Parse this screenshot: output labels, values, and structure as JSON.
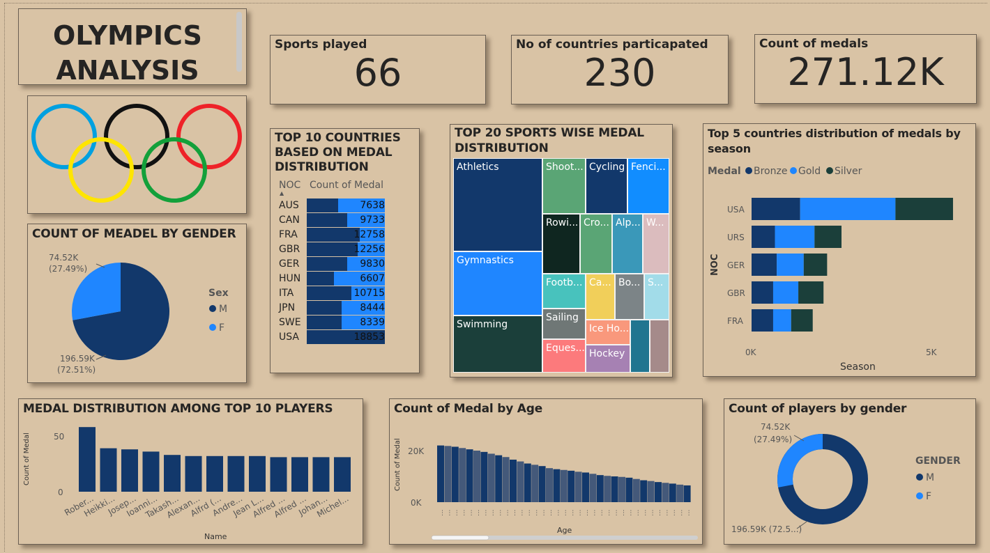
{
  "title": {
    "line1": "OLYMPICS",
    "line2": "ANALYSIS"
  },
  "kpis": [
    {
      "label": "Sports played",
      "value": "66"
    },
    {
      "label": "No of countries particapated",
      "value": "230"
    },
    {
      "label": "Count of medals",
      "value": "271.12K"
    }
  ],
  "colors": {
    "background": "#d9c3a5",
    "dark_blue": "#12386b",
    "mid_blue": "#1f86ff",
    "dark_green": "#1b3f3a"
  },
  "gender_pie": {
    "title": "COUNT OF MEADEL BY GENDER",
    "legend_title": "Sex",
    "legend": [
      "M",
      "F"
    ],
    "label_f": "74.52K",
    "label_f_pct": "(27.49%)",
    "label_m": "196.59K",
    "label_m_pct": "(72.51%)"
  },
  "top10_table": {
    "title_l1": "TOP 10 COUNTRIES",
    "title_l2": "BASED ON MEDAL",
    "title_l3": "DISTRIBUTION",
    "col_noc": "NOC",
    "col_count": "Count of Medal",
    "rows": [
      {
        "noc": "AUS",
        "count": "7638"
      },
      {
        "noc": "CAN",
        "count": "9733"
      },
      {
        "noc": "FRA",
        "count": "12758"
      },
      {
        "noc": "GBR",
        "count": "12256"
      },
      {
        "noc": "GER",
        "count": "9830"
      },
      {
        "noc": "HUN",
        "count": "6607"
      },
      {
        "noc": "ITA",
        "count": "10715"
      },
      {
        "noc": "JPN",
        "count": "8444"
      },
      {
        "noc": "SWE",
        "count": "8339"
      },
      {
        "noc": "USA",
        "count": "18853"
      }
    ]
  },
  "treemap": {
    "title_l1": "TOP 20 SPORTS WISE MEDAL",
    "title_l2": "DISTRIBUTION",
    "labels": [
      "Athletics",
      "Gymnastics",
      "Swimming",
      "Shoot...",
      "Cycling",
      "Fenci...",
      "Rowi...",
      "Cro...",
      "Alp...",
      "W...",
      "Footb...",
      "Ca...",
      "Bo...",
      "S...",
      "Sailing",
      "Ice Ho...",
      "Eques...",
      "Hockey"
    ]
  },
  "season_chart": {
    "title_l1": "Top 5 countries distribution of medals by",
    "title_l2": "season",
    "legend_title": "Medal",
    "legend": [
      "Bronze",
      "Gold",
      "Silver"
    ],
    "xlabel": "Season",
    "ylabel": "NOC",
    "xticks": [
      "0K",
      "5K"
    ]
  },
  "players_chart": {
    "title": "MEDAL DISTRIBUTION AMONG TOP 10 PLAYERS",
    "xlabel": "Name",
    "ylabel": "Count of Medal",
    "yticks": [
      "50",
      "0"
    ]
  },
  "age_chart": {
    "title": "Count of Medal by Age",
    "xlabel": "Age",
    "ylabel": "Count of Medal",
    "yticks": [
      "20K",
      "0K"
    ]
  },
  "donut": {
    "title": "Count of players by gender",
    "legend_title": "GENDER",
    "legend": [
      "M",
      "F"
    ],
    "label_f": "74.52K",
    "label_f_pct": "(27.49%)",
    "label_m": "196.59K (72.5...)"
  },
  "chart_data": [
    {
      "type": "pie",
      "title": "COUNT OF MEADEL BY GENDER",
      "categories": [
        "M",
        "F"
      ],
      "values": [
        196590,
        74520
      ]
    },
    {
      "type": "table",
      "title": "TOP 10 COUNTRIES BASED ON MEDAL DISTRIBUTION",
      "categories": [
        "AUS",
        "CAN",
        "FRA",
        "GBR",
        "GER",
        "HUN",
        "ITA",
        "JPN",
        "SWE",
        "USA"
      ],
      "values": [
        7638,
        9733,
        12758,
        12256,
        9830,
        6607,
        10715,
        8444,
        8339,
        18853
      ]
    },
    {
      "type": "bar",
      "title": "Top 5 countries distribution of medals by season",
      "categories": [
        "USA",
        "URS",
        "GER",
        "GBR",
        "FRA"
      ],
      "series": [
        {
          "name": "Bronze",
          "values": [
            1350,
            650,
            700,
            600,
            600
          ]
        },
        {
          "name": "Gold",
          "values": [
            2650,
            1100,
            750,
            700,
            500
          ]
        },
        {
          "name": "Silver",
          "values": [
            1600,
            750,
            650,
            700,
            600
          ]
        }
      ],
      "xlim": [
        0,
        5600
      ]
    },
    {
      "type": "bar",
      "title": "MEDAL DISTRIBUTION AMONG TOP 10 PLAYERS",
      "categories": [
        "Rober...",
        "Heikki...",
        "Josep...",
        "Ioanni...",
        "Takash...",
        "Alexan...",
        "Alfrd (...",
        "Andre...",
        "Jean L...",
        "Alfred ...",
        "Alfred ...",
        "Johan...",
        "Michel..."
      ],
      "values": [
        58,
        39,
        38,
        36,
        33,
        32,
        32,
        32,
        32,
        31,
        31,
        31,
        31
      ],
      "ylim": [
        0,
        65
      ]
    },
    {
      "type": "bar",
      "title": "Count of Medal by Age",
      "values": [
        22000,
        21800,
        21500,
        21000,
        20500,
        20000,
        19500,
        18800,
        18200,
        17500,
        16500,
        15800,
        15000,
        14500,
        14000,
        13200,
        12800,
        12500,
        12200,
        11800,
        11500,
        11000,
        10500,
        10200,
        10000,
        9800,
        9500,
        9000,
        8500,
        8200,
        7800,
        7500,
        7200,
        6800,
        6500
      ],
      "ylim": [
        0,
        25000
      ]
    },
    {
      "type": "pie",
      "title": "Count of players by gender",
      "categories": [
        "M",
        "F"
      ],
      "values": [
        196590,
        74520
      ]
    }
  ]
}
